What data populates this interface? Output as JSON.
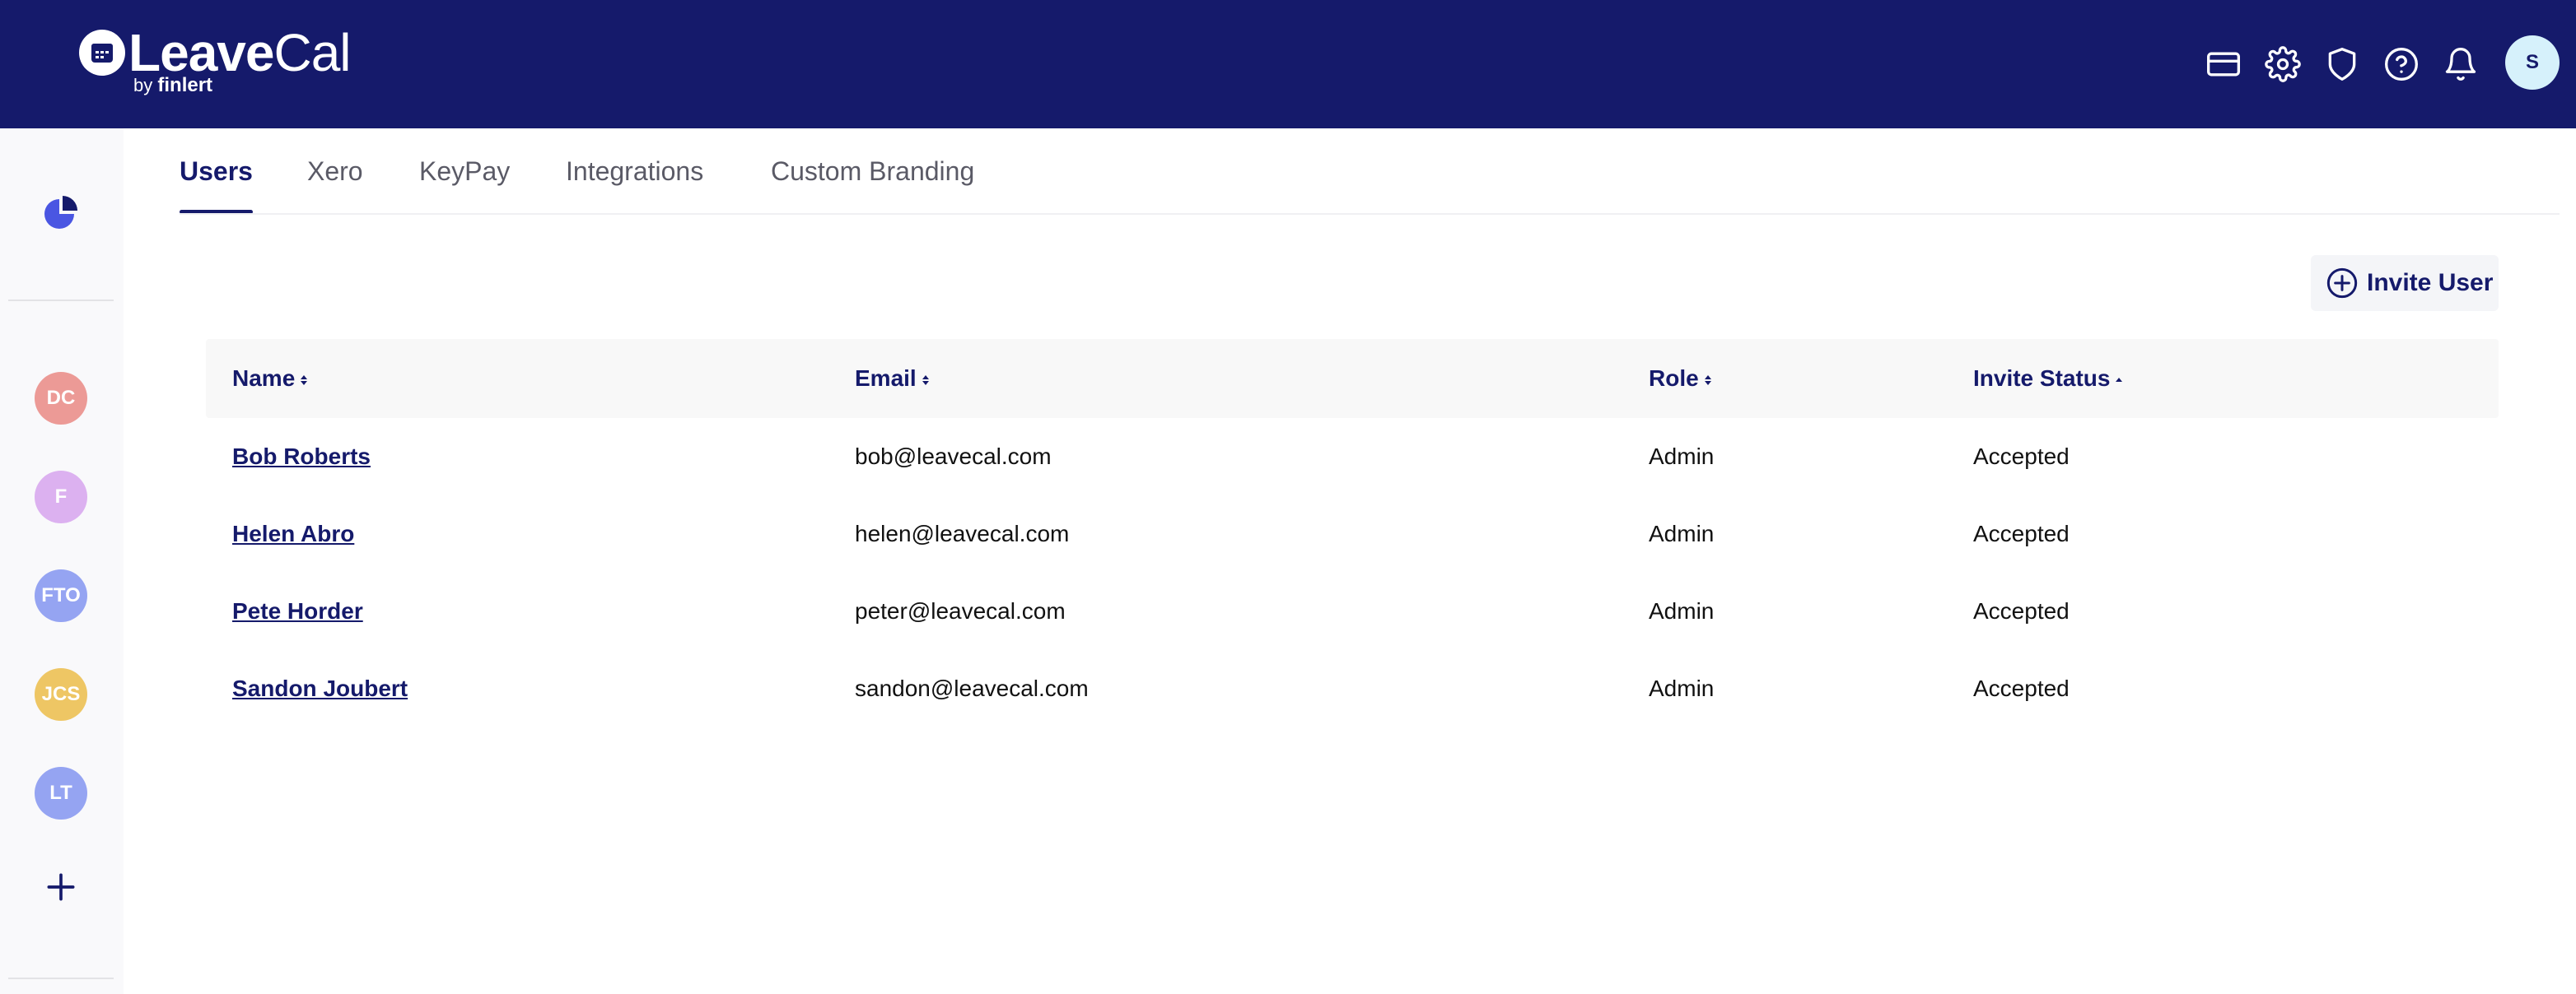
{
  "app": {
    "logo_bold": "Leave",
    "logo_light": "Cal",
    "logo_by": "by",
    "logo_brand": "finlert"
  },
  "header": {
    "icons": [
      "billing-card-icon",
      "gear-icon",
      "shield-icon",
      "help-icon",
      "bell-icon"
    ],
    "avatar_initial": "S",
    "avatar_color": "#d6f1fb"
  },
  "sidebar": {
    "home_icon": "pie-chart-icon",
    "avatars": [
      {
        "initials": "DC",
        "color": "#ec9a96"
      },
      {
        "initials": "F",
        "color": "#dcb1f0"
      },
      {
        "initials": "FTO",
        "color": "#95a4f2"
      },
      {
        "initials": "JCS",
        "color": "#eec664"
      },
      {
        "initials": "LT",
        "color": "#95a4f2"
      }
    ],
    "add_icon": "plus-icon"
  },
  "tabs": [
    {
      "label": "Users",
      "active": true
    },
    {
      "label": "Xero",
      "active": false
    },
    {
      "label": "KeyPay",
      "active": false
    },
    {
      "label": "Integrations",
      "active": false
    },
    {
      "label": "Custom Branding",
      "active": false
    }
  ],
  "actions": {
    "invite_label": "Invite User"
  },
  "table": {
    "columns": [
      "Name",
      "Email",
      "Role",
      "Invite Status"
    ],
    "rows": [
      {
        "name": "Bob Roberts",
        "email": "bob@leavecal.com",
        "role": "Admin",
        "status": "Accepted"
      },
      {
        "name": "Helen Abro",
        "email": "helen@leavecal.com",
        "role": "Admin",
        "status": "Accepted"
      },
      {
        "name": "Pete Horder",
        "email": "peter@leavecal.com",
        "role": "Admin",
        "status": "Accepted"
      },
      {
        "name": "Sandon Joubert",
        "email": "sandon@leavecal.com",
        "role": "Admin",
        "status": "Accepted"
      }
    ]
  },
  "colors": {
    "brand_navy": "#151a6b",
    "accent_blue": "#4a56e2"
  }
}
